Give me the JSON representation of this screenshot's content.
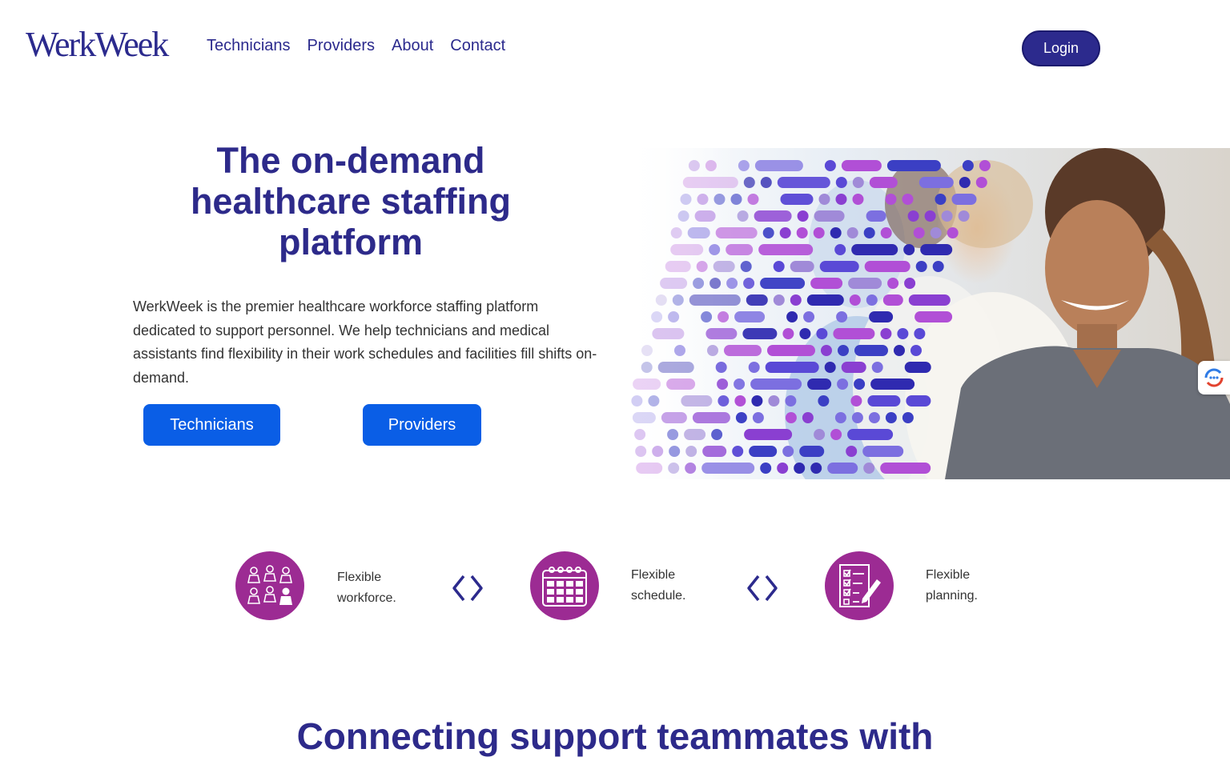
{
  "header": {
    "logo": "WerkWeek",
    "nav": [
      "Technicians",
      "Providers",
      "About",
      "Contact"
    ],
    "login_label": "Login"
  },
  "hero": {
    "title": "The on-demand healthcare staffing platform",
    "description": "WerkWeek is the premier healthcare workforce staffing platform dedicated to support personnel. We help technicians and medical assistants find flexibility in their work schedules and facilities fill shifts on-demand.",
    "technicians_button": "Technicians",
    "providers_button": "Providers"
  },
  "features": [
    {
      "icon": "people-icon",
      "line1": "Flexible",
      "line2": "workforce."
    },
    {
      "icon": "calendar-icon",
      "line1": "Flexible",
      "line2": "schedule."
    },
    {
      "icon": "checklist-icon",
      "line1": "Flexible",
      "line2": "planning."
    }
  ],
  "section": {
    "title": "Connecting support teammates with"
  },
  "colors": {
    "brand": "#2c2a8d",
    "button_blue": "#0a5ee6",
    "feature_purple": "#9c2b93"
  }
}
